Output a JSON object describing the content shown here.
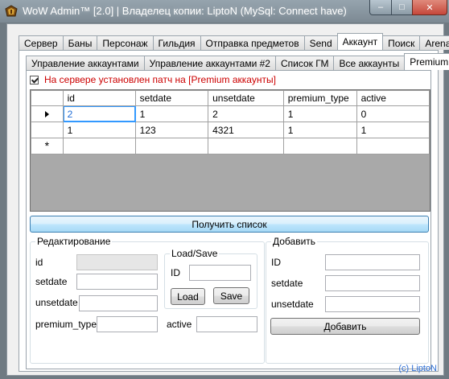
{
  "window": {
    "title": "WoW Admin™ [2.0] | Владелец копии: LiptoN (MySql: Connect have)",
    "controls": {
      "minimize": "–",
      "maximize": "□",
      "close": "✕"
    }
  },
  "main_tabs": [
    "Сервер",
    "Баны",
    "Персонаж",
    "Гильдия",
    "Отправка предметов",
    "Send",
    "Аккаунт",
    "Поиск",
    "Arena"
  ],
  "main_tab_active": "Аккаунт",
  "sub_tabs": [
    "Управление аккаунтами",
    "Управление аккаунтами #2",
    "Список ГМ",
    "Все аккаунты",
    "Premium"
  ],
  "sub_tab_active": "Premium",
  "premium_patch_checkbox": {
    "label": "На сервере установлен патч на [Premium аккаунты]",
    "checked": true
  },
  "grid": {
    "columns": [
      "id",
      "setdate",
      "unsetdate",
      "premium_type",
      "active"
    ],
    "rows": [
      [
        "2",
        "1",
        "2",
        "1",
        "0"
      ],
      [
        "1",
        "123",
        "4321",
        "1",
        "1"
      ]
    ],
    "new_row_marker": "*"
  },
  "get_list_button": "Получить список",
  "edit_group": {
    "title": "Редактирование",
    "id_label": "id",
    "setdate_label": "setdate",
    "unsetdate_label": "unsetdate",
    "premium_type_label": "premium_type",
    "active_label": "active"
  },
  "loadsave_group": {
    "title": "Load/Save",
    "id_label": "ID",
    "load_button": "Load",
    "save_button": "Save"
  },
  "add_group": {
    "title": "Добавить",
    "id_label": "ID",
    "setdate_label": "setdate",
    "unsetdate_label": "unsetdate",
    "add_button": "Добавить"
  },
  "copyright": "(c) LiptoN"
}
